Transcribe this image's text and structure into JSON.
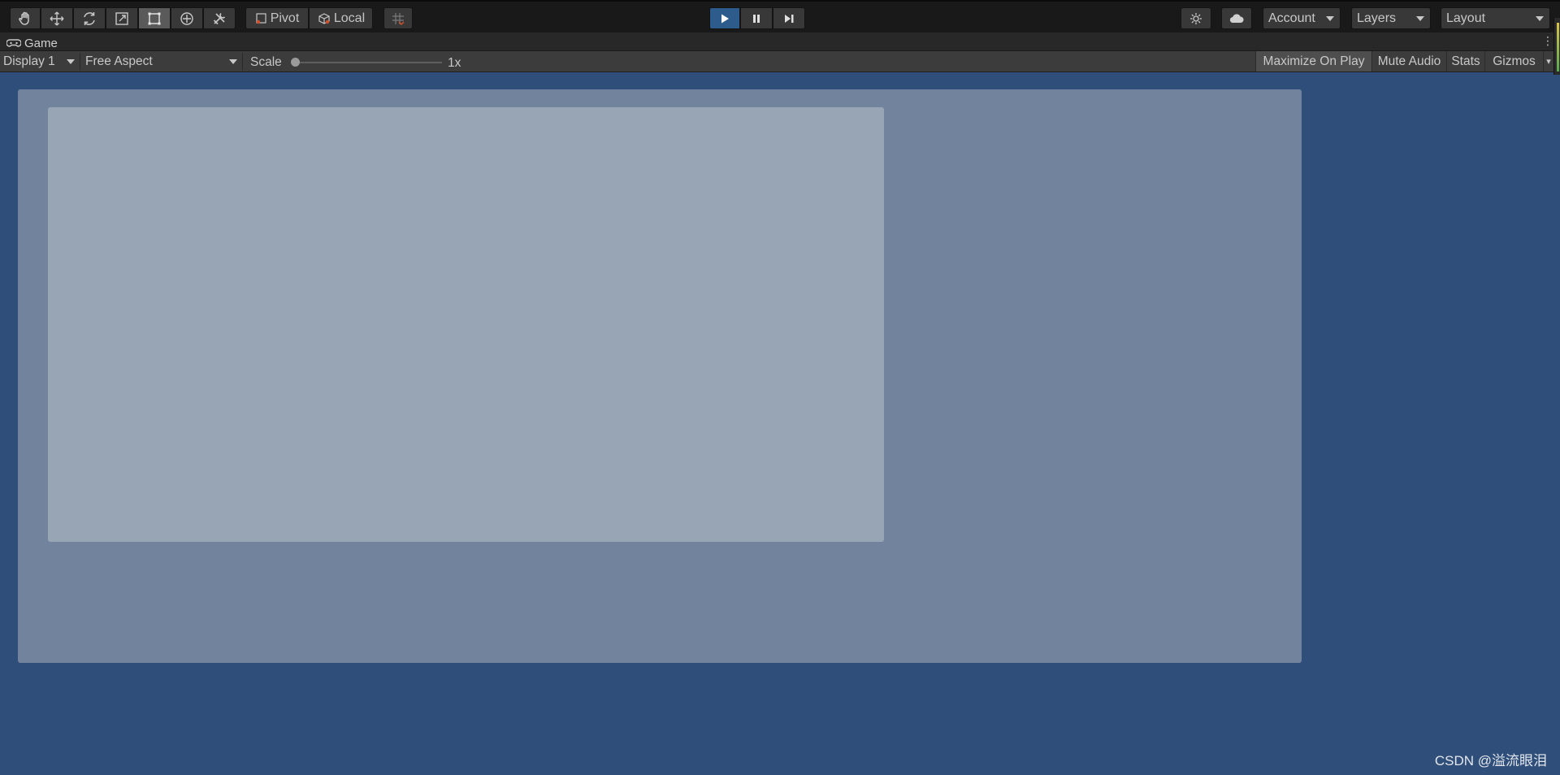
{
  "toolbar": {
    "tools": [
      {
        "name": "hand-tool-button",
        "icon": "hand-icon"
      },
      {
        "name": "move-tool-button",
        "icon": "move-icon"
      },
      {
        "name": "rotate-tool-button",
        "icon": "rotate-icon"
      },
      {
        "name": "scale-tool-button",
        "icon": "scale-icon"
      },
      {
        "name": "rect-tool-button",
        "icon": "rect-transform-icon",
        "active": true
      },
      {
        "name": "transform-tool-button",
        "icon": "transform-icon"
      },
      {
        "name": "custom-tool-button",
        "icon": "tools-icon"
      }
    ],
    "pivot_label": "Pivot",
    "local_label": "Local",
    "grid_snap_icon": "grid-snap-icon",
    "play_icon": "play-icon",
    "pause_icon": "pause-icon",
    "step_icon": "step-icon",
    "collab_icon": "services-icon",
    "cloud_icon": "cloud-icon",
    "account_label": "Account",
    "layers_label": "Layers",
    "layout_label": "Layout"
  },
  "tab": {
    "icon": "gamepad-icon",
    "label": "Game",
    "menu_icon": "kebab-menu-icon"
  },
  "controls": {
    "display_label": "Display 1",
    "aspect_label": "Free Aspect",
    "scale_label": "Scale",
    "scale_value": "1x",
    "scale_fraction": 0.0,
    "maximize_label": "Maximize On Play",
    "mute_label": "Mute Audio",
    "stats_label": "Stats",
    "gizmos_label": "Gizmos"
  },
  "colors": {
    "game_background": "#2f4e79",
    "outer_panel": "#72849d",
    "inner_panel": "#98a5b5",
    "play_active": "#2d5b8c",
    "toolbar": "#191919"
  },
  "watermark": "CSDN @溢流眼泪"
}
